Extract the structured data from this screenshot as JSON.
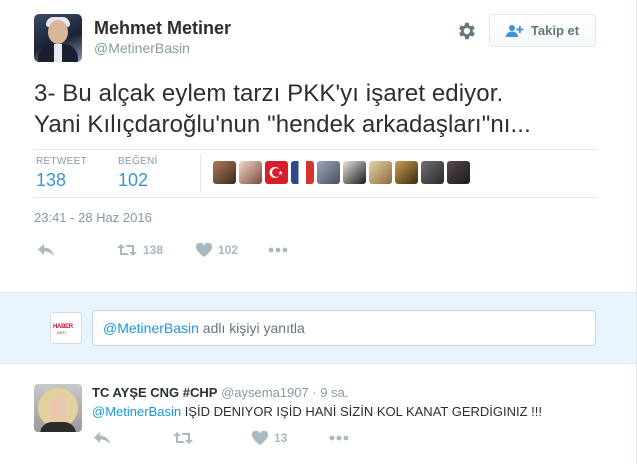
{
  "author": {
    "name": "Mehmet Metiner",
    "handle": "@MetinerBasin"
  },
  "header": {
    "follow_label": "Takip et",
    "settings_icon": "gear-icon",
    "follow_icon": "add-user-icon"
  },
  "tweet": {
    "line1": "3- Bu alçak eylem tarzı PKK'yı işaret ediyor.",
    "line2": "Yani Kılıçdaroğlu'nun \"hendek arkadaşları\"nı...",
    "timestamp": "23:41 - 28 Haz 2016"
  },
  "stats": {
    "retweet_label": "RETWEET",
    "retweet_count": "138",
    "like_label": "BEĞENİ",
    "like_count": "102"
  },
  "likers": [
    "liker-avatar-1",
    "liker-avatar-2",
    "liker-avatar-3",
    "liker-avatar-4",
    "liker-avatar-5",
    "liker-avatar-6",
    "liker-avatar-7",
    "liker-avatar-8",
    "liker-avatar-9"
  ],
  "actions": {
    "retweet_count": "138",
    "like_count": "102"
  },
  "reply_box": {
    "avatar_text_1": "HABER",
    "avatar_text_2": "ARTI",
    "mention": "@MetinerBasin",
    "placeholder_rest": " adlı kişiyi yanıtla"
  },
  "reply": {
    "name": "TC AYŞE CNG #CHP",
    "handle": "@aysema1907",
    "time": "· 9 sa.",
    "mention": "@MetinerBasin",
    "text": " IŞİD DENIYOR IŞİD HANİ SİZİN KOL KANAT GERDİGINIZ !!!",
    "like_count": "13"
  },
  "colors": {
    "link": "#1b95e0",
    "stat_value": "#3b94d9",
    "muted": "#8899a6",
    "reply_bg": "#e8f5fd"
  }
}
